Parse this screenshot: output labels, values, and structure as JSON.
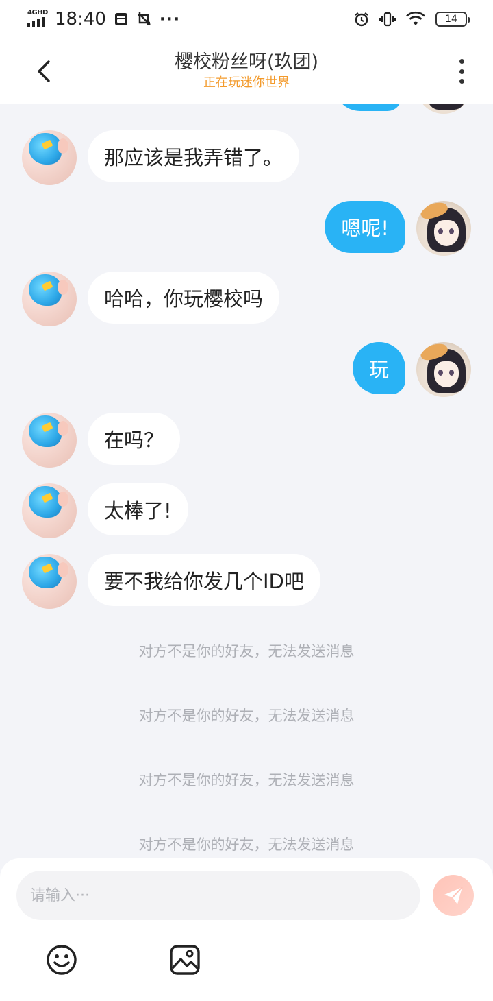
{
  "status_bar": {
    "network": "4GHD",
    "time": "18:40",
    "more": "···",
    "battery": "14"
  },
  "header": {
    "title": "樱校粉丝呀(玖团)",
    "subtitle": "正在玩迷你世界"
  },
  "messages": [
    {
      "from": "other",
      "text": "那应该是我弄错了。"
    },
    {
      "from": "me",
      "text": "嗯呢!"
    },
    {
      "from": "other",
      "text": "哈哈，你玩樱校吗"
    },
    {
      "from": "me",
      "text": "玩"
    },
    {
      "from": "other",
      "text": "在吗？"
    },
    {
      "from": "other",
      "text": "太棒了!"
    },
    {
      "from": "other",
      "text": "要不我给你发几个ID吧"
    }
  ],
  "system_notes": [
    "对方不是你的好友，无法发送消息",
    "对方不是你的好友，无法发送消息",
    "对方不是你的好友，无法发送消息",
    "对方不是你的好友，无法发送消息"
  ],
  "composer": {
    "placeholder": "请输入···",
    "value": ""
  },
  "icons": {
    "back": "chevron-left-icon",
    "more": "more-vertical-icon",
    "send": "paper-plane-icon",
    "emoji": "smiley-icon",
    "image": "image-icon"
  },
  "colors": {
    "my_bubble": "#29b3f5",
    "subtitle": "#f39a2b",
    "send_button": "#ffc4b8"
  }
}
